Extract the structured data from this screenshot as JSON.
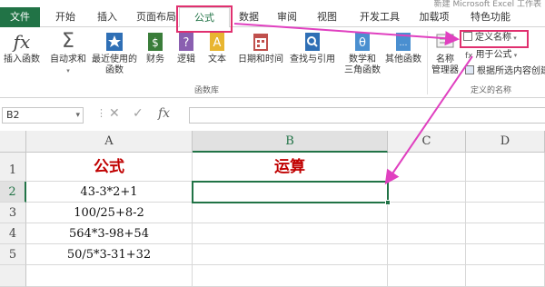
{
  "title_bar": {
    "text": "新建 Microsoft Excel 工作表"
  },
  "tabs": [
    "文件",
    "开始",
    "插入",
    "页面布局",
    "公式",
    "数据",
    "审阅",
    "视图",
    "开发工具",
    "加载项",
    "特色功能"
  ],
  "active_tab": "公式",
  "ribbon": {
    "insert_function": "插入函数",
    "autosum": "自动求和",
    "recent_1": "最近使用的",
    "recent_2": "函数",
    "financial": "财务",
    "logical": "逻辑",
    "text": "文本",
    "datetime": "日期和时间",
    "lookup": "查找与引用",
    "math_1": "数学和",
    "math_2": "三角函数",
    "more": "其他函数",
    "function_library": "函数库",
    "name_manager_1": "名称",
    "name_manager_2": "管理器",
    "define_name": "定义名称",
    "use_in_formula": "用于公式",
    "create_from_selection": "根据所选内容创建",
    "defined_names": "定义的名称"
  },
  "formula_bar": {
    "name_box": "B2",
    "fx": "fx",
    "value": ""
  },
  "grid": {
    "columns": [
      "A",
      "B",
      "C",
      "D"
    ],
    "rows": [
      "1",
      "2",
      "3",
      "4",
      "5"
    ],
    "selected_cell": "B2",
    "cells": {
      "A1": "公式",
      "B1": "运算",
      "A2": "43-3*2+1",
      "A3": "100/25+8-2",
      "A4": "564*3-98+54",
      "A5": "50/5*3-31+32"
    }
  },
  "colors": {
    "accent": "#217346",
    "highlight": "#e0306f",
    "header_text": "#c00000"
  }
}
